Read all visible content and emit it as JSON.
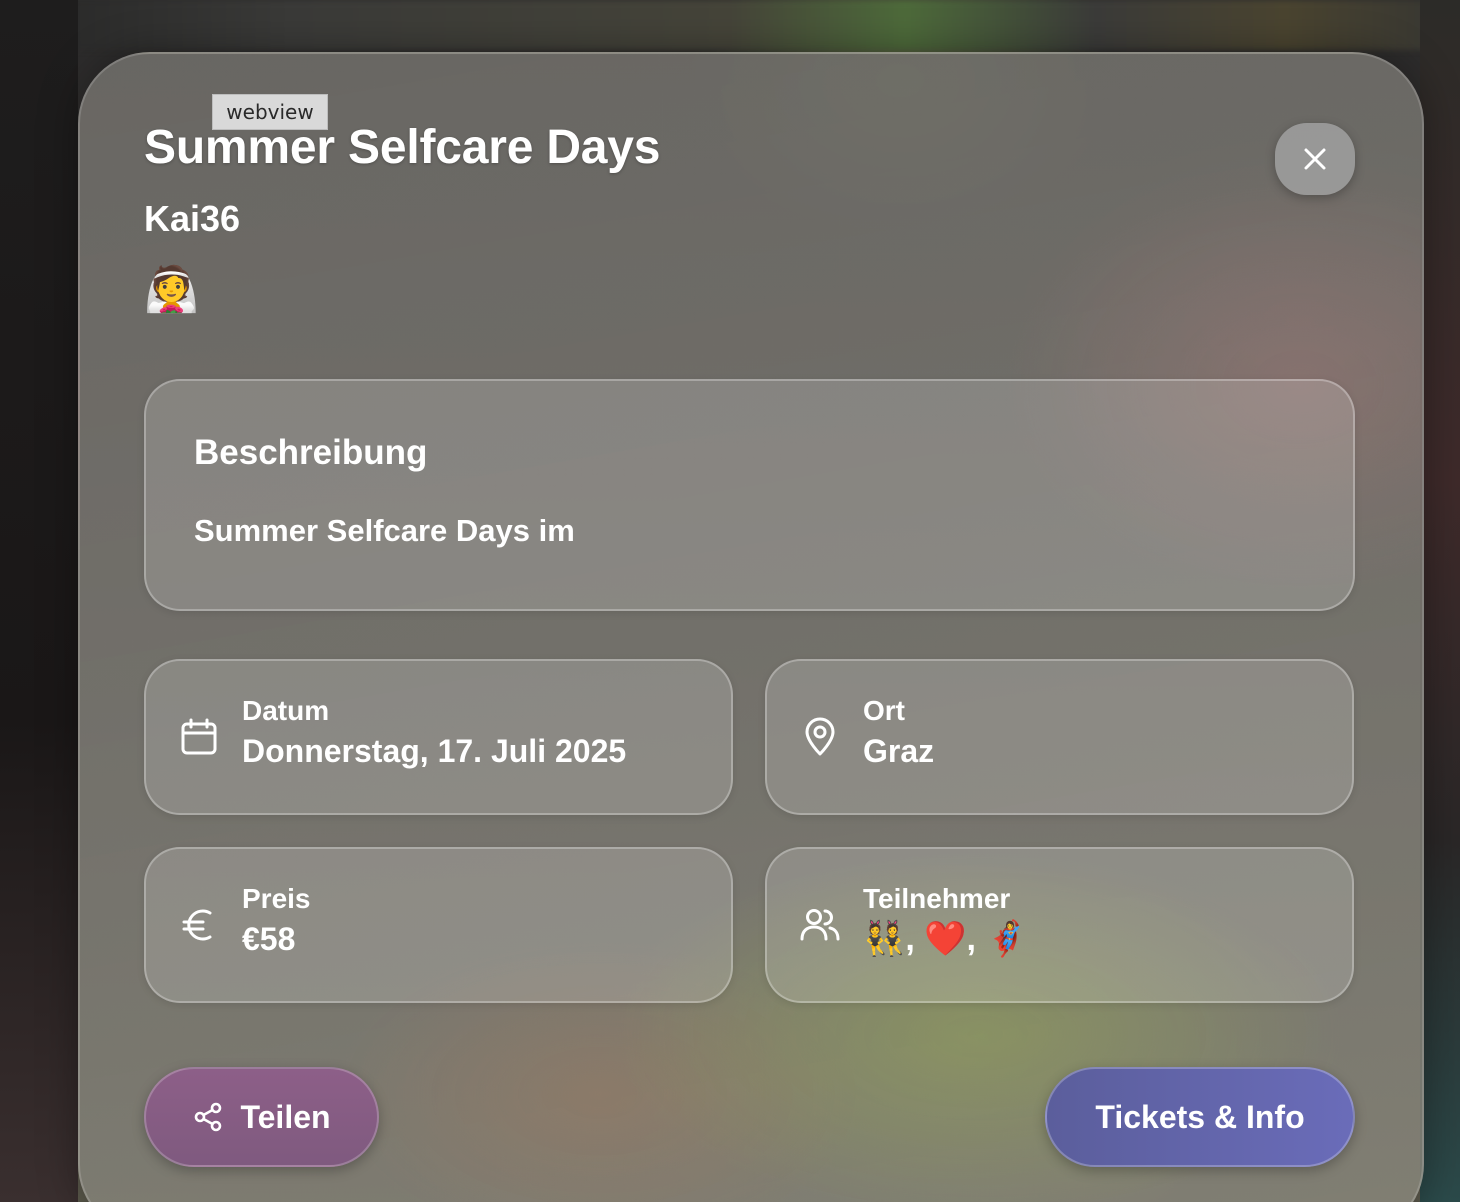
{
  "tooltip": "webview",
  "event": {
    "title": "Summer Selfcare Days",
    "organizer": "Kai36",
    "avatar": "👰"
  },
  "description": {
    "heading": "Beschreibung",
    "text": "Summer Selfcare Days im"
  },
  "info": {
    "date": {
      "label": "Datum",
      "value": "Donnerstag, 17. Juli 2025",
      "icon": "calendar-icon"
    },
    "place": {
      "label": "Ort",
      "value": "Graz",
      "icon": "map-pin-icon"
    },
    "price": {
      "label": "Preis",
      "value": "€58",
      "icon": "euro-icon"
    },
    "participants": {
      "label": "Teilnehmer",
      "value": "👯, ❤️, 🦸‍♀️",
      "icon": "users-icon"
    }
  },
  "actions": {
    "share_label": "Teilen",
    "tickets_label": "Tickets & Info"
  },
  "colors": {
    "share_button": "#8d5f88",
    "tickets_button": "#6a6cb9"
  }
}
